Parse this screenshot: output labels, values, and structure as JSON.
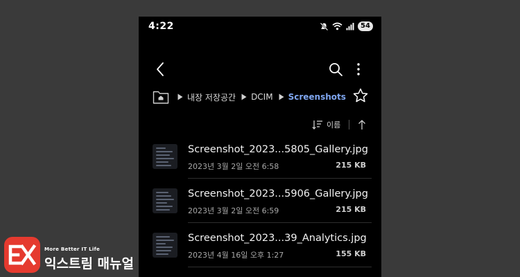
{
  "status_bar": {
    "time": "4:22",
    "battery": "54",
    "icons": [
      "mute-icon",
      "wifi-icon",
      "signal-icon",
      "battery-icon"
    ]
  },
  "toolbar": {
    "icons": [
      "back-arrow-icon",
      "search-icon",
      "more-vertical-icon"
    ]
  },
  "breadcrumb": {
    "items": [
      {
        "label": "내장 저장공간",
        "active": false
      },
      {
        "label": "DCIM",
        "active": false
      },
      {
        "label": "Screenshots",
        "active": true
      }
    ],
    "icons": [
      "folder-home-icon",
      "chevron-right-icon",
      "star-outline-icon"
    ]
  },
  "sort": {
    "label": "이름",
    "icons": [
      "sort-icon",
      "arrow-up-icon"
    ]
  },
  "files": [
    {
      "name": "Screenshot_2023...5805_Gallery.jpg",
      "date": "2023년 3월 2일 오전 6:58",
      "size": "215 KB"
    },
    {
      "name": "Screenshot_2023...5906_Gallery.jpg",
      "date": "2023년 3월 2일 오전 6:59",
      "size": "215 KB"
    },
    {
      "name": "Screenshot_2023...39_Analytics.jpg",
      "date": "2023년 4월 16일 오후 1:27",
      "size": "155 KB"
    }
  ],
  "logo": {
    "tagline": "More Better IT Life",
    "name": "익스트림 매뉴얼",
    "brand_color": "#e53a2f"
  },
  "colors": {
    "background": "#3a3a3a",
    "screen": "#000000",
    "accent": "#7fa6f0",
    "text": "#f2f2f2",
    "secondary_text": "#a8a8a8"
  }
}
